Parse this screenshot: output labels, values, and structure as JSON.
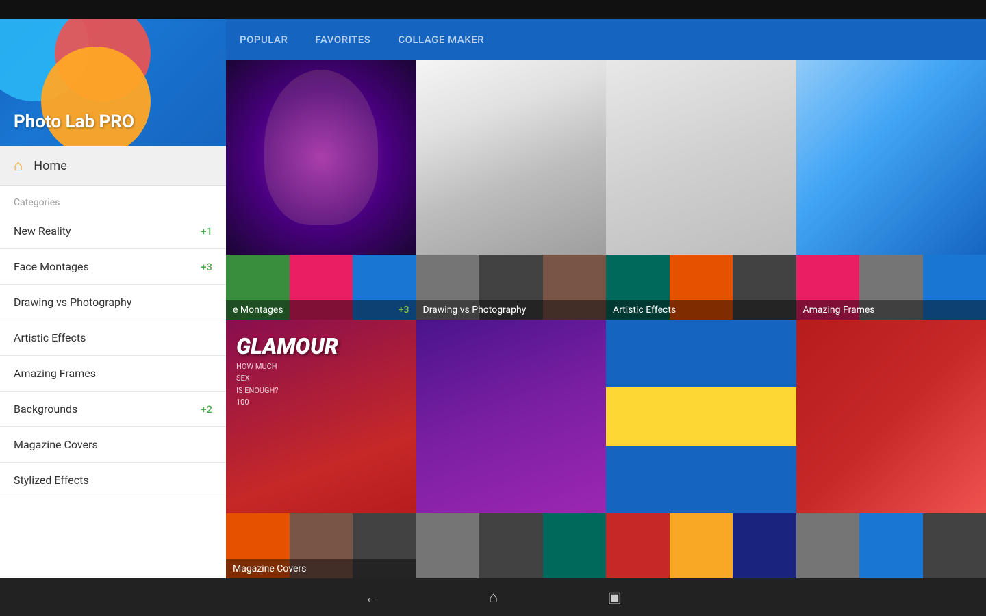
{
  "app": {
    "title": "Photo Lab PRO",
    "top_bar_height": 28,
    "bottom_bar_height": 55
  },
  "header": {
    "tabs": [
      {
        "id": "popular",
        "label": "POPULAR",
        "active": false
      },
      {
        "id": "favorites",
        "label": "FAVORITES",
        "active": false
      },
      {
        "id": "collage_maker",
        "label": "COLLAGE MAKER",
        "active": false
      }
    ]
  },
  "sidebar": {
    "home_label": "Home",
    "categories_label": "Categories",
    "nav_items": [
      {
        "id": "new-reality",
        "label": "New Reality",
        "badge": "+1"
      },
      {
        "id": "face-montages",
        "label": "Face Montages",
        "badge": "+3"
      },
      {
        "id": "drawing-vs-photography",
        "label": "Drawing vs Photography",
        "badge": ""
      },
      {
        "id": "artistic-effects",
        "label": "Artistic Effects",
        "badge": ""
      },
      {
        "id": "amazing-frames",
        "label": "Amazing Frames",
        "badge": ""
      },
      {
        "id": "backgrounds",
        "label": "Backgrounds",
        "badge": "+2"
      },
      {
        "id": "magazine-covers",
        "label": "Magazine Covers",
        "badge": ""
      },
      {
        "id": "stylized-effects",
        "label": "Stylized Effects",
        "badge": ""
      }
    ]
  },
  "grid": {
    "cells": [
      {
        "id": "face-montages-cell",
        "label": "e Montages",
        "badge": "+3",
        "main_img_class": "astro-sim",
        "thumbs": [
          "thumb-green",
          "thumb-pink",
          "thumb-blue"
        ]
      },
      {
        "id": "drawing-vs-photography-cell",
        "label": "Drawing vs Photography",
        "badge": "",
        "main_img_class": "sketch-face-sim",
        "thumbs": [
          "thumb-gray",
          "thumb-dark",
          "thumb-brown"
        ]
      },
      {
        "id": "artistic-effects-cell",
        "label": "Artistic Effects",
        "badge": "",
        "main_img_class": "img-sketch-tree",
        "thumbs": [
          "thumb-teal",
          "thumb-orange",
          "thumb-dark"
        ]
      },
      {
        "id": "amazing-frames-cell",
        "label": "Amazing Frames",
        "badge": "",
        "main_img_class": "img-frames",
        "thumbs": [
          "thumb-pink",
          "thumb-gray",
          "thumb-blue"
        ]
      },
      {
        "id": "magazine-covers-cell",
        "label": "Magazine Covers",
        "badge": "",
        "main_img_class": "img-glamour",
        "thumbs": [
          "thumb-orange",
          "thumb-brown",
          "thumb-dark"
        ]
      },
      {
        "id": "girl-purple-cell",
        "label": "",
        "badge": "",
        "main_img_class": "img-girl-purple",
        "thumbs": [
          "thumb-gray",
          "thumb-dark",
          "thumb-teal"
        ]
      },
      {
        "id": "flag-cell",
        "label": "",
        "badge": "",
        "main_img_class": "img-flag",
        "thumbs": [
          "thumb-red",
          "thumb-yellow",
          "thumb-navy"
        ]
      },
      {
        "id": "sports-cell",
        "label": "",
        "badge": "",
        "main_img_class": "img-sports",
        "thumbs": [
          "thumb-gray",
          "thumb-blue",
          "thumb-dark"
        ]
      }
    ]
  },
  "bottom_nav": {
    "back_icon": "←",
    "home_icon": "⌂",
    "recents_icon": "▣"
  }
}
